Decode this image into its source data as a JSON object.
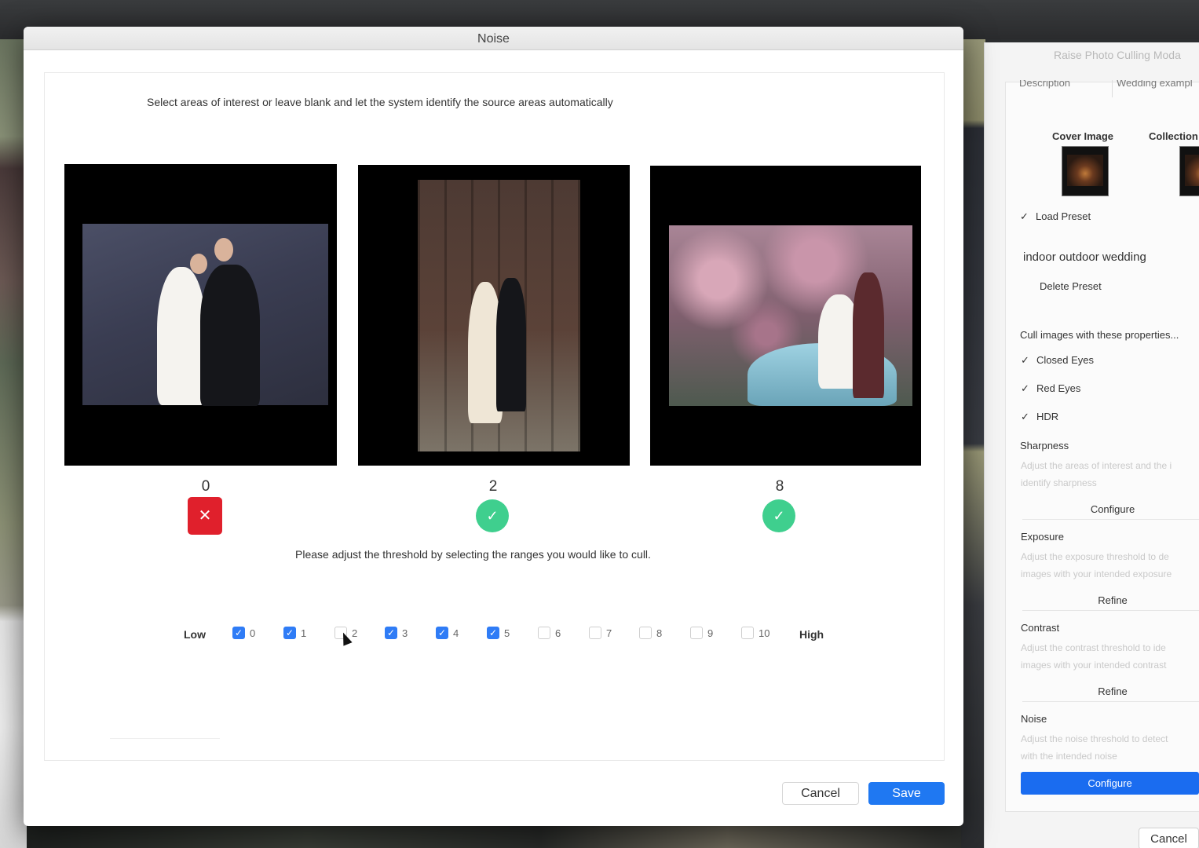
{
  "dialog": {
    "title": "Noise",
    "instructions": "Select areas of interest or leave blank and let the system identify the source areas automatically",
    "threshold_text": "Please adjust the threshold by selecting the ranges you would like to cull.",
    "photos": [
      {
        "score": "0",
        "status": "rejected",
        "status_icon": "✕"
      },
      {
        "score": "2",
        "status": "accepted",
        "status_icon": "✓"
      },
      {
        "score": "8",
        "status": "accepted",
        "status_icon": "✓"
      }
    ],
    "scale": {
      "low_label": "Low",
      "high_label": "High",
      "levels": [
        {
          "label": "0",
          "checked": true
        },
        {
          "label": "1",
          "checked": true
        },
        {
          "label": "2",
          "checked": false
        },
        {
          "label": "3",
          "checked": true
        },
        {
          "label": "4",
          "checked": true
        },
        {
          "label": "5",
          "checked": true
        },
        {
          "label": "6",
          "checked": false
        },
        {
          "label": "7",
          "checked": false
        },
        {
          "label": "8",
          "checked": false
        },
        {
          "label": "9",
          "checked": false
        },
        {
          "label": "10",
          "checked": false
        }
      ]
    },
    "cancel_label": "Cancel",
    "save_label": "Save"
  },
  "right_panel": {
    "title": "Raise Photo Culling Moda",
    "tabs": [
      "Description",
      "Wedding exampl"
    ],
    "cover_image_label": "Cover Image",
    "collection_label": "Collection",
    "load_preset_label": "Load Preset",
    "preset_name": "indoor outdoor wedding",
    "delete_preset_label": "Delete Preset",
    "cull_heading": "Cull images with these properties...",
    "properties": [
      "Closed Eyes",
      "Red Eyes",
      "HDR"
    ],
    "sections": [
      {
        "title": "Sharpness",
        "desc1": "Adjust the areas of interest and the i",
        "desc2": "identify sharpness",
        "button": "Configure"
      },
      {
        "title": "Exposure",
        "desc1": "Adjust the exposure threshold to de",
        "desc2": "images with your intended exposure",
        "button": "Refine"
      },
      {
        "title": "Contrast",
        "desc1": "Adjust the contrast threshold to ide",
        "desc2": "images with your intended contrast",
        "button": "Refine"
      },
      {
        "title": "Noise",
        "desc1": "Adjust the noise threshold to detect",
        "desc2": "with the intended noise",
        "button": "Configure"
      }
    ],
    "cancel_label": "Cancel"
  },
  "colors": {
    "accent_blue": "#1f78f2",
    "reject_red": "#e0202c",
    "accept_green": "#3fcf8e"
  }
}
